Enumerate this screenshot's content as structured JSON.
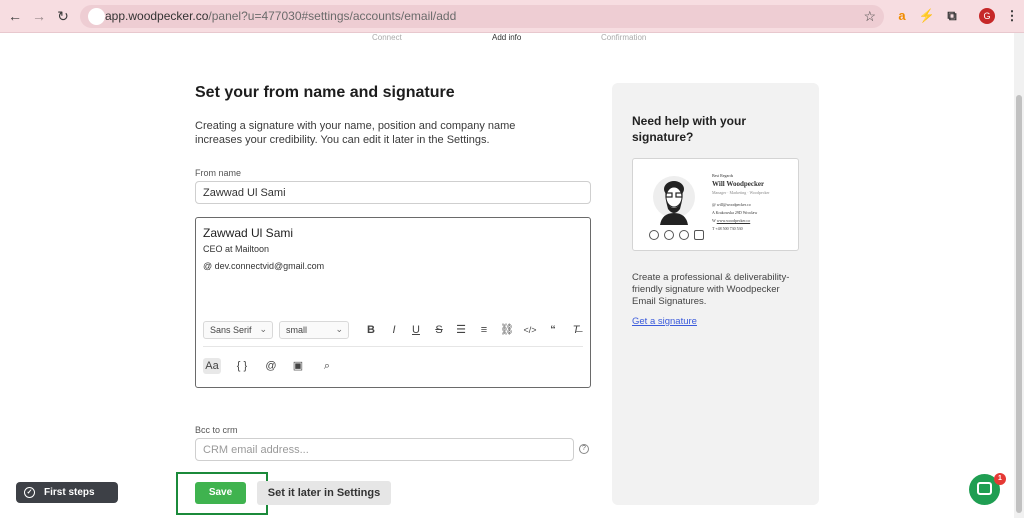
{
  "browser": {
    "url_host": "app.woodpecker.co",
    "url_path": "/panel?u=477030#settings/accounts/email/add",
    "profile_initial": "G"
  },
  "steps": [
    "Connect",
    "Add info",
    "Confirmation"
  ],
  "main": {
    "title": "Set your from name and signature",
    "description": "Creating a signature with your name, position and company name increases your credibility. You can edit it later in the Settings.",
    "from_name_label": "From name",
    "from_name_value": "Zawwad Ul Sami",
    "signature": {
      "name": "Zawwad Ul Sami",
      "line1": "CEO at Mailtoon",
      "line2": "@ dev.connectvid@gmail.com"
    },
    "editor_toolbar": {
      "font": "Sans Serif",
      "size": "small"
    },
    "bcc_label": "Bcc to crm",
    "bcc_placeholder": "CRM email address...",
    "save_label": "Save",
    "later_label": "Set it later in Settings"
  },
  "sidebar": {
    "title": "Need help with your signature?",
    "card": {
      "greeting": "Best Regards",
      "name": "Will Woodpecker",
      "role": "Manager · Marketing · Woodpecker",
      "email": "will@woodpecker.co",
      "address": "Krakowska 29D Wroclaw",
      "web": "www.woodpecker.co",
      "phone": "+48 500 730 530"
    },
    "text": "Create a professional & deliverability-friendly signature with Woodpecker Email Signatures.",
    "link": "Get a signature"
  },
  "first_steps_label": "First steps",
  "chat_badge": "1"
}
